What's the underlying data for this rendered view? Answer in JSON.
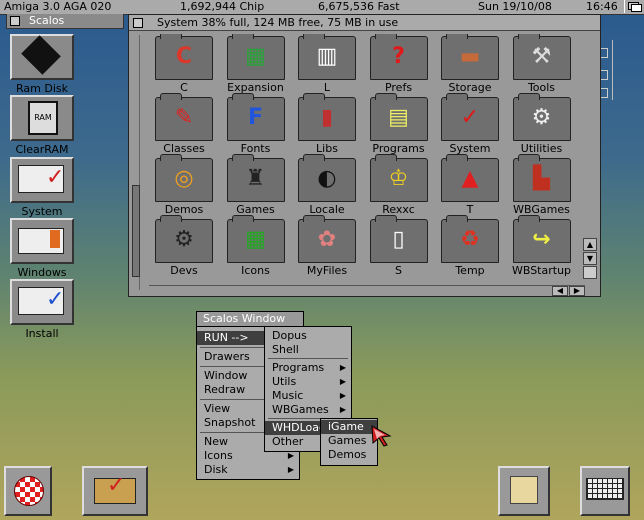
{
  "screenbar": {
    "system": "Amiga 3.0 AGA 020",
    "chip": "1,692,944 Chip",
    "fast": "6,675,536 Fast",
    "date": "Sun  19/10/08",
    "time": "16:46"
  },
  "scalos_tab": "Scalos",
  "desktop_icons": [
    {
      "label": "Ram Disk",
      "icon": "ram-chip-icon"
    },
    {
      "label": "ClearRAM",
      "icon": "ram-clear-icon"
    },
    {
      "label": "System",
      "icon": "system-volume-icon"
    },
    {
      "label": "Windows",
      "icon": "windows-volume-icon"
    },
    {
      "label": "Install",
      "icon": "install-volume-icon"
    }
  ],
  "window": {
    "title": "System  38% full, 124 MB free, 75 MB in use",
    "drawers": [
      {
        "label": "C",
        "icon": "c-icon",
        "glyph": "C",
        "color": "#d9382a"
      },
      {
        "label": "Expansion",
        "icon": "board-icon",
        "glyph": "▦",
        "color": "#2aa43a"
      },
      {
        "label": "L",
        "icon": "ribbon-icon",
        "glyph": "▥",
        "color": "#ffffff"
      },
      {
        "label": "Prefs",
        "icon": "question-icon",
        "glyph": "?",
        "color": "#e21818"
      },
      {
        "label": "Storage",
        "icon": "chest-icon",
        "glyph": "▬",
        "color": "#c56a3a"
      },
      {
        "label": "Tools",
        "icon": "tools-icon",
        "glyph": "⚒",
        "color": "#dddddd"
      },
      {
        "label": "Classes",
        "icon": "pen-icon",
        "glyph": "✎",
        "color": "#e02020"
      },
      {
        "label": "Fonts",
        "icon": "font-icon",
        "glyph": "F",
        "color": "#2255dd"
      },
      {
        "label": "Libs",
        "icon": "books-icon",
        "glyph": "▮",
        "color": "#c03030"
      },
      {
        "label": "Programs",
        "icon": "programs-icon",
        "glyph": "▤",
        "color": "#eeee66"
      },
      {
        "label": "System",
        "icon": "check-icon",
        "glyph": "✓",
        "color": "#e01818"
      },
      {
        "label": "Utilities",
        "icon": "wrench-icon",
        "glyph": "⚙",
        "color": "#eeeeee"
      },
      {
        "label": "Demos",
        "icon": "swirl-icon",
        "glyph": "◎",
        "color": "#f0a020"
      },
      {
        "label": "Games",
        "icon": "joystick-icon",
        "glyph": "♜",
        "color": "#222222"
      },
      {
        "label": "Locale",
        "icon": "globe-icon",
        "glyph": "◐",
        "color": "#111111"
      },
      {
        "label": "Rexxc",
        "icon": "crown-icon",
        "glyph": "♔",
        "color": "#f2d020"
      },
      {
        "label": "T",
        "icon": "t-sign-icon",
        "glyph": "▲",
        "color": "#e02020"
      },
      {
        "label": "WBGames",
        "icon": "blocks-icon",
        "glyph": "▙",
        "color": "#c03020"
      },
      {
        "label": "Devs",
        "icon": "gears-icon",
        "glyph": "⚙",
        "color": "#222222"
      },
      {
        "label": "Icons",
        "icon": "grid-icon",
        "glyph": "▦",
        "color": "#22aa22"
      },
      {
        "label": "MyFiles",
        "icon": "files-icon",
        "glyph": "✿",
        "color": "#e08080"
      },
      {
        "label": "S",
        "icon": "script-icon",
        "glyph": "▯",
        "color": "#ffffff"
      },
      {
        "label": "Temp",
        "icon": "trash-icon",
        "glyph": "♻",
        "color": "#e03020"
      },
      {
        "label": "WBStartup",
        "icon": "startup-icon",
        "glyph": "↪",
        "color": "#eeee44"
      }
    ]
  },
  "menu": {
    "title": "Scalos Window",
    "main": [
      "RUN -->",
      "Drawers",
      "Window",
      "Redraw",
      "View",
      "Snapshot",
      "New",
      "Icons",
      "Disk"
    ],
    "run_sub": [
      "Dopus",
      "Shell",
      "Programs",
      "Utils",
      "Music",
      "WBGames",
      "WHDLoad",
      "Other"
    ],
    "whd_sub": [
      "iGame",
      "Games",
      "Demos"
    ]
  }
}
